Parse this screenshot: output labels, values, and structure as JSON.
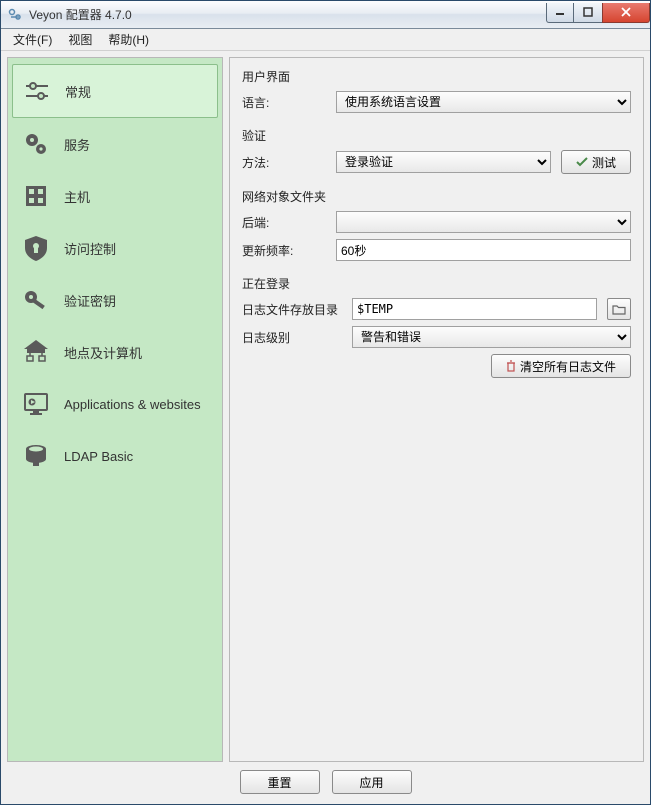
{
  "window": {
    "title": "Veyon 配置器 4.7.0"
  },
  "menu": {
    "file": "文件(F)",
    "view": "视图",
    "help": "帮助(H)"
  },
  "sidebar": {
    "items": [
      {
        "label": "常规"
      },
      {
        "label": "服务"
      },
      {
        "label": "主机"
      },
      {
        "label": "访问控制"
      },
      {
        "label": "验证密钥"
      },
      {
        "label": "地点及计算机"
      },
      {
        "label": "Applications & websites"
      },
      {
        "label": "LDAP Basic"
      }
    ]
  },
  "ui": {
    "group_ui": "用户界面",
    "language_label": "语言:",
    "language_value": "使用系统语言设置",
    "group_auth": "验证",
    "method_label": "方法:",
    "method_value": "登录验证",
    "test_btn": "测试",
    "group_net": "网络对象文件夹",
    "backend_label": "后端:",
    "backend_value": "",
    "update_label": "更新频率:",
    "update_value": "60秒",
    "group_log": "正在登录",
    "logdir_label": "日志文件存放目录",
    "logdir_value": "$TEMP",
    "loglevel_label": "日志级别",
    "loglevel_value": "警告和错误",
    "clearlogs_btn": "清空所有日志文件"
  },
  "footer": {
    "reset": "重置",
    "apply": "应用"
  }
}
